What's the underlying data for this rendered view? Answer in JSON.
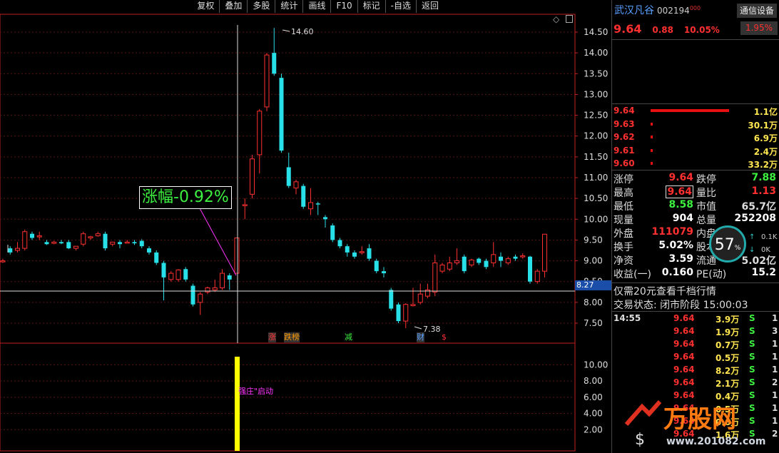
{
  "toolbar": [
    "复权",
    "叠加",
    "多股",
    "统计",
    "画线",
    "F10",
    "标记",
    "-自选",
    "返回"
  ],
  "chart_data": {
    "type": "candlestick",
    "y_axis": [
      "14.50",
      "14.00",
      "13.50",
      "13.00",
      "12.50",
      "12.00",
      "11.50",
      "11.00",
      "10.50",
      "10.00",
      "9.50",
      "9.00",
      "8.50",
      "8.00",
      "7.50"
    ],
    "y_min": 7.25,
    "y_max": 14.75,
    "high_label": "14.60",
    "high_value": 14.6,
    "low_label": "7.38",
    "low_value": 7.38,
    "crosshair_price": "8.27",
    "change_annotation": "涨幅-0.92%",
    "candles": [
      {
        "o": 9.0,
        "h": 9.05,
        "c": 9.0,
        "l": 8.95
      },
      {
        "o": 9.3,
        "h": 9.35,
        "c": 9.2,
        "l": 9.15
      },
      {
        "o": 9.25,
        "h": 9.45,
        "c": 9.3,
        "l": 9.2
      },
      {
        "o": 9.3,
        "h": 9.75,
        "c": 9.7,
        "l": 9.25
      },
      {
        "o": 9.65,
        "h": 9.7,
        "c": 9.55,
        "l": 9.5
      },
      {
        "o": 9.6,
        "h": 9.7,
        "c": 9.6,
        "l": 9.5
      },
      {
        "o": 9.45,
        "h": 9.5,
        "c": 9.4,
        "l": 9.38
      },
      {
        "o": 9.42,
        "h": 9.48,
        "c": 9.45,
        "l": 9.4
      },
      {
        "o": 9.45,
        "h": 9.5,
        "c": 9.42,
        "l": 9.4
      },
      {
        "o": 9.45,
        "h": 9.5,
        "c": 9.3,
        "l": 9.28
      },
      {
        "o": 9.3,
        "h": 9.35,
        "c": 9.35,
        "l": 9.25
      },
      {
        "o": 9.4,
        "h": 9.7,
        "c": 9.65,
        "l": 9.35
      },
      {
        "o": 9.55,
        "h": 9.6,
        "c": 9.58,
        "l": 9.5
      },
      {
        "o": 9.6,
        "h": 9.7,
        "c": 9.65,
        "l": 9.58
      },
      {
        "o": 9.65,
        "h": 9.7,
        "c": 9.3,
        "l": 9.25
      },
      {
        "o": 9.4,
        "h": 9.45,
        "c": 9.45,
        "l": 9.35
      },
      {
        "o": 9.45,
        "h": 9.5,
        "c": 9.4,
        "l": 9.3
      },
      {
        "o": 9.45,
        "h": 9.5,
        "c": 9.45,
        "l": 9.42
      },
      {
        "o": 9.45,
        "h": 9.5,
        "c": 9.42,
        "l": 9.38
      },
      {
        "o": 9.48,
        "h": 9.52,
        "c": 9.35,
        "l": 9.3
      },
      {
        "o": 9.3,
        "h": 9.35,
        "c": 9.2,
        "l": 9.15
      },
      {
        "o": 9.2,
        "h": 9.25,
        "c": 8.95,
        "l": 8.9
      },
      {
        "o": 8.95,
        "h": 9.0,
        "c": 8.6,
        "l": 8.05
      },
      {
        "o": 8.55,
        "h": 8.75,
        "c": 8.7,
        "l": 8.5
      },
      {
        "o": 8.55,
        "h": 8.8,
        "c": 8.78,
        "l": 8.5
      },
      {
        "o": 8.8,
        "h": 8.85,
        "c": 8.55,
        "l": 8.5
      },
      {
        "o": 8.4,
        "h": 8.45,
        "c": 7.95,
        "l": 7.9
      },
      {
        "o": 8.0,
        "h": 8.25,
        "c": 8.2,
        "l": 7.7
      },
      {
        "o": 8.25,
        "h": 8.38,
        "c": 8.35,
        "l": 8.2
      },
      {
        "o": 8.3,
        "h": 8.55,
        "c": 8.35,
        "l": 8.25
      },
      {
        "o": 8.35,
        "h": 8.8,
        "c": 8.7,
        "l": 8.3
      },
      {
        "o": 8.65,
        "h": 8.7,
        "c": 8.55,
        "l": 8.3
      },
      {
        "o": 8.7,
        "h": 9.55,
        "c": 9.55,
        "l": 8.7
      },
      {
        "o": 10.35,
        "h": 10.5,
        "c": 10.35,
        "l": 10.0
      },
      {
        "o": 10.6,
        "h": 11.55,
        "c": 11.45,
        "l": 10.5
      },
      {
        "o": 11.55,
        "h": 12.65,
        "c": 12.6,
        "l": 11.1
      },
      {
        "o": 12.7,
        "h": 14.0,
        "c": 13.95,
        "l": 12.6
      },
      {
        "o": 14.0,
        "h": 14.6,
        "c": 13.5,
        "l": 13.45
      },
      {
        "o": 13.4,
        "h": 13.5,
        "c": 11.65,
        "l": 11.6
      },
      {
        "o": 11.25,
        "h": 11.6,
        "c": 10.8,
        "l": 10.75
      },
      {
        "o": 10.75,
        "h": 10.95,
        "c": 10.9,
        "l": 10.6
      },
      {
        "o": 10.8,
        "h": 10.85,
        "c": 10.3,
        "l": 10.25
      },
      {
        "o": 10.25,
        "h": 10.75,
        "c": 10.4,
        "l": 10.1
      },
      {
        "o": 10.38,
        "h": 10.42,
        "c": 10.36,
        "l": 10.1
      },
      {
        "o": 10.05,
        "h": 10.1,
        "c": 10.0,
        "l": 9.8
      },
      {
        "o": 9.85,
        "h": 9.9,
        "c": 9.5,
        "l": 9.45
      },
      {
        "o": 9.5,
        "h": 9.55,
        "c": 9.35,
        "l": 9.3
      },
      {
        "o": 9.35,
        "h": 9.4,
        "c": 9.2,
        "l": 9.1
      },
      {
        "o": 9.2,
        "h": 9.25,
        "c": 9.1,
        "l": 9.05
      },
      {
        "o": 9.2,
        "h": 9.35,
        "c": 9.22,
        "l": 9.15
      },
      {
        "o": 9.3,
        "h": 9.4,
        "c": 9.05,
        "l": 9.0
      },
      {
        "o": 9.0,
        "h": 9.05,
        "c": 8.75,
        "l": 8.7
      },
      {
        "o": 8.75,
        "h": 8.85,
        "c": 8.7,
        "l": 8.6
      },
      {
        "o": 8.3,
        "h": 8.35,
        "c": 7.85,
        "l": 7.8
      },
      {
        "o": 7.95,
        "h": 8.0,
        "c": 7.55,
        "l": 7.5
      },
      {
        "o": 7.55,
        "h": 7.98,
        "c": 7.95,
        "l": 7.38
      },
      {
        "o": 7.92,
        "h": 8.35,
        "c": 7.95,
        "l": 7.9
      },
      {
        "o": 8.0,
        "h": 8.45,
        "c": 8.2,
        "l": 7.95
      },
      {
        "o": 8.15,
        "h": 8.45,
        "c": 8.3,
        "l": 8.1
      },
      {
        "o": 8.25,
        "h": 9.15,
        "c": 8.95,
        "l": 8.15
      },
      {
        "o": 8.75,
        "h": 8.95,
        "c": 8.9,
        "l": 8.7
      },
      {
        "o": 8.8,
        "h": 9.1,
        "c": 8.95,
        "l": 8.75
      },
      {
        "o": 8.95,
        "h": 9.3,
        "c": 9.0,
        "l": 8.9
      },
      {
        "o": 9.1,
        "h": 9.15,
        "c": 8.75,
        "l": 8.7
      },
      {
        "o": 8.9,
        "h": 9.05,
        "c": 9.02,
        "l": 8.85
      },
      {
        "o": 9.05,
        "h": 9.08,
        "c": 8.95,
        "l": 8.9
      },
      {
        "o": 9.0,
        "h": 9.05,
        "c": 8.85,
        "l": 8.8
      },
      {
        "o": 8.95,
        "h": 9.45,
        "c": 9.15,
        "l": 8.85
      },
      {
        "o": 9.1,
        "h": 9.2,
        "c": 9.0,
        "l": 8.85
      },
      {
        "o": 8.95,
        "h": 9.1,
        "c": 9.05,
        "l": 8.9
      },
      {
        "o": 9.1,
        "h": 9.15,
        "c": 9.05,
        "l": 9.0
      },
      {
        "o": 9.12,
        "h": 9.18,
        "c": 9.12,
        "l": 9.05
      },
      {
        "o": 9.1,
        "h": 9.12,
        "c": 8.5,
        "l": 8.45
      },
      {
        "o": 8.5,
        "h": 8.8,
        "c": 8.75,
        "l": 8.45
      },
      {
        "o": 8.75,
        "h": 9.64,
        "c": 9.64,
        "l": 8.6
      }
    ],
    "signals": [
      {
        "text": "涨",
        "color": "#ff3030",
        "bg": "#333"
      },
      {
        "text": "跌榜",
        "color": "#ff9900",
        "bg": "#333"
      },
      {
        "text": "减",
        "color": "#3df040",
        "bg": "#000"
      },
      {
        "text": "财",
        "color": "#58a0ff",
        "bg": "#333"
      },
      {
        "text": "$",
        "color": "#ff3030",
        "bg": "#000"
      }
    ],
    "indicator": {
      "y_axis": [
        "10.00",
        "8.00",
        "6.00",
        "4.00",
        "2.00"
      ],
      "y_min": 0,
      "y_max": 11,
      "label": "强庄\"启动",
      "bar_value": 11
    }
  },
  "stock": {
    "name": "武汉凡谷",
    "code": "002194",
    "sup": "000",
    "price": "9.64",
    "change": "0.88",
    "pct": "10.05%",
    "comm_button": "通信设备",
    "badge": "1.95%"
  },
  "orderbook": [
    {
      "price": "9.64",
      "vol": "1.1亿",
      "ratio": 1.0
    },
    {
      "price": "9.63",
      "vol": "30.1万",
      "ratio": 0.02
    },
    {
      "price": "9.62",
      "vol": "6.9万",
      "ratio": 0.02
    },
    {
      "price": "9.61",
      "vol": "2.4万",
      "ratio": 0.02
    },
    {
      "price": "9.60",
      "vol": "33.2万",
      "ratio": 0.02
    }
  ],
  "stats": {
    "zt_k": "涨停",
    "zt_v": "9.64",
    "dt_k": "跌停",
    "dt_v": "7.88",
    "zg_k": "最高",
    "zg_v": "9.64",
    "lb_k": "量比",
    "lb_v": "1.13",
    "zd_k": "最低",
    "zd_v": "8.58",
    "sz_k": "市值",
    "sz_v": "65.7亿",
    "xl_k": "现量",
    "xl_v": "904",
    "zl_k": "总量",
    "zl_v": "252208",
    "wp_k": "外盘",
    "wp_v": "111079",
    "np_k": "内盘",
    "hs_k": "换手",
    "hs_v": "5.02%",
    "gb_k": "股本",
    "jz_k": "净资",
    "jz_v": "3.59",
    "lt_k": "流通",
    "lt_v": "5.02亿",
    "sy_k": "收益(一)",
    "sy_v": "0.160",
    "pe_k": "PE(动)",
    "pe_v": "15.2"
  },
  "gauge": {
    "value": "57",
    "unit": "%",
    "up": "0.1K",
    "down": "0K"
  },
  "notice": "仅需20元查看千档行情",
  "status": "交易状态: 闭市阶段 15:00:03",
  "ticks": [
    {
      "time": "14:55",
      "price": "9.64",
      "vol": "3.9万",
      "side": "S",
      "n": "1"
    },
    {
      "time": "",
      "price": "9.64",
      "vol": "1.9万",
      "side": "S",
      "n": "3"
    },
    {
      "time": "",
      "price": "9.64",
      "vol": "0.7万",
      "side": "S",
      "n": "1"
    },
    {
      "time": "",
      "price": "9.64",
      "vol": "0.5万",
      "side": "S",
      "n": "1"
    },
    {
      "time": "",
      "price": "9.64",
      "vol": "8.2万",
      "side": "S",
      "n": "1"
    },
    {
      "time": "",
      "price": "9.64",
      "vol": "2.1万",
      "side": "S",
      "n": "2"
    },
    {
      "time": "",
      "price": "9.64",
      "vol": "0.4万",
      "side": "S",
      "n": "1"
    },
    {
      "time": "",
      "price": "9.64",
      "vol": "0.5万",
      "side": "S",
      "n": "1"
    },
    {
      "time": "",
      "price": "9.64",
      "vol": "0.6万",
      "side": "S",
      "n": "1"
    },
    {
      "time": "",
      "price": "9.64",
      "vol": "1.6万",
      "side": "S",
      "n": "2"
    }
  ],
  "watermark": {
    "text": "万股网",
    "url": "www.201082.com"
  },
  "colors": {
    "up": "#ff3030",
    "down": "#28e0e8",
    "grid": "#5a1414",
    "axis": "#c02020"
  }
}
